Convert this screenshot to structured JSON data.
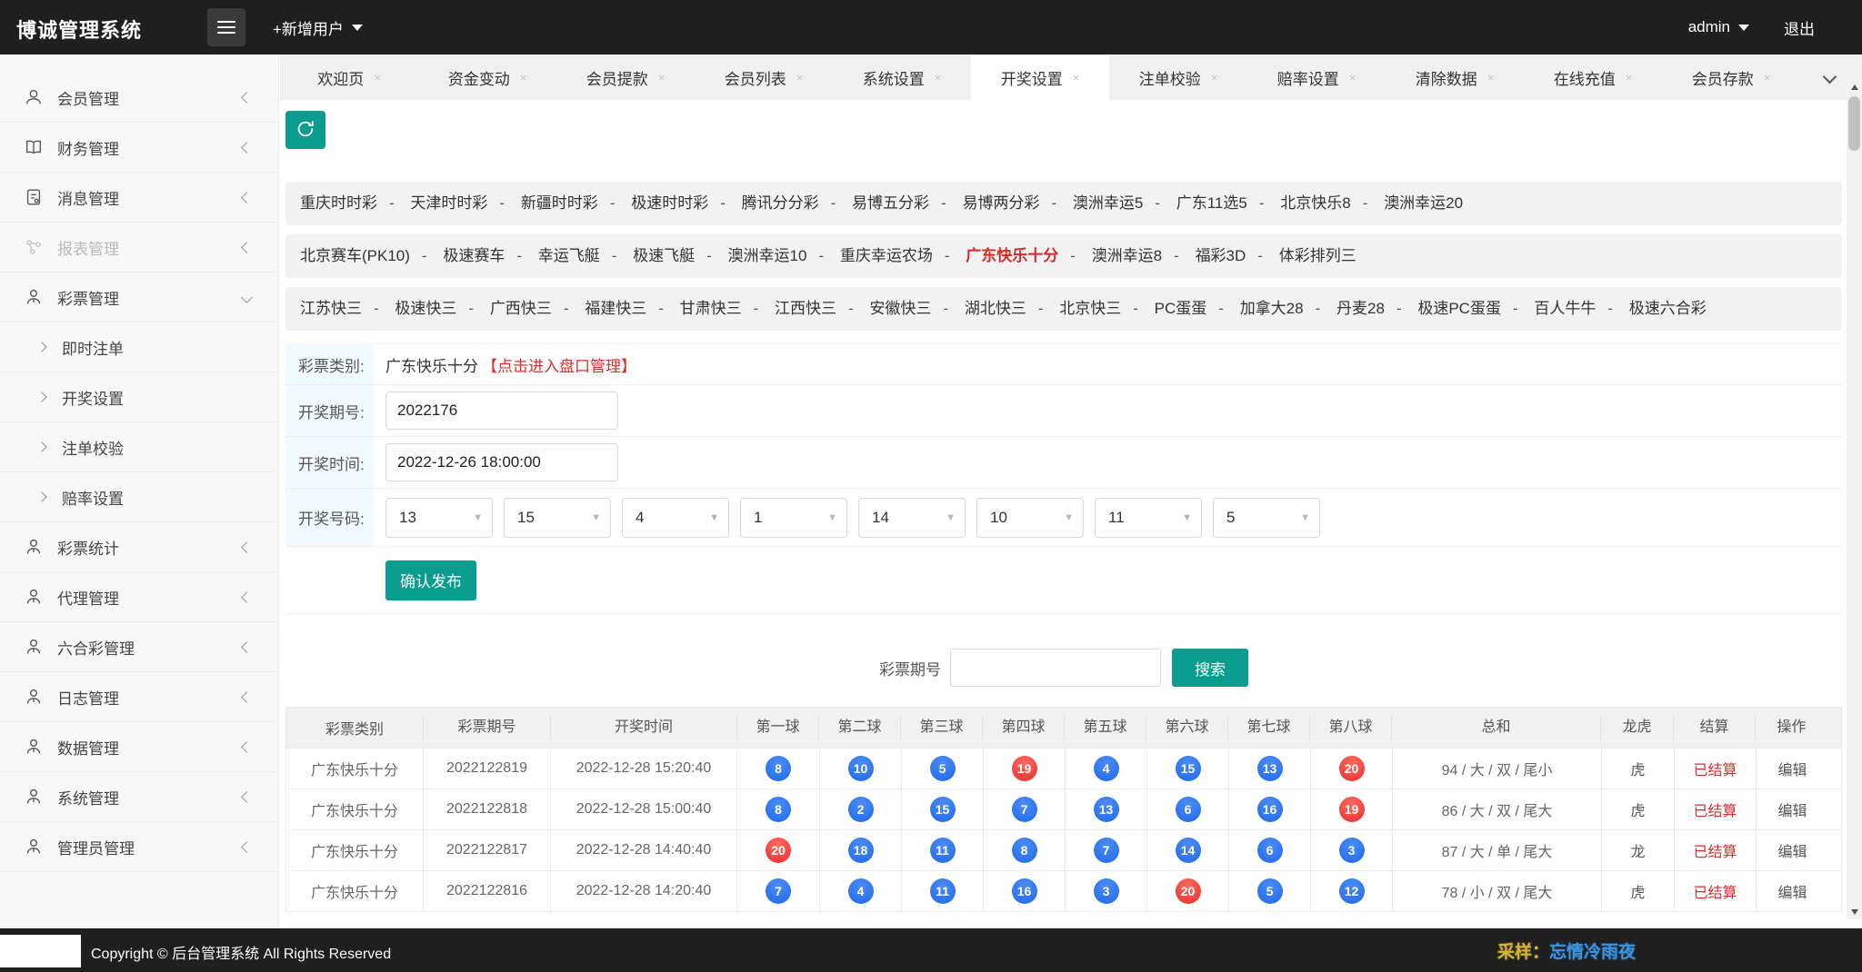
{
  "topbar": {
    "title": "博诚管理系统",
    "add_user_label": "+新增用户",
    "username": "admin",
    "logout_label": "退出"
  },
  "icons": {
    "close": "×",
    "select_caret": "▼"
  },
  "tabs": [
    {
      "label": "欢迎页",
      "active": "false"
    },
    {
      "label": "资金变动",
      "active": "false"
    },
    {
      "label": "会员提款",
      "active": "false"
    },
    {
      "label": "会员列表",
      "active": "false"
    },
    {
      "label": "系统设置",
      "active": "false"
    },
    {
      "label": "开奖设置",
      "active": "true"
    },
    {
      "label": "注单校验",
      "active": "false"
    },
    {
      "label": "赔率设置",
      "active": "false"
    },
    {
      "label": "清除数据",
      "active": "false"
    },
    {
      "label": "在线充值",
      "active": "false"
    },
    {
      "label": "会员存款",
      "active": "false"
    }
  ],
  "sidebar": {
    "items": [
      {
        "label": "会员管理",
        "icon": "user",
        "type": "top",
        "chevron": "left",
        "disabled": "false"
      },
      {
        "label": "财务管理",
        "icon": "book",
        "type": "top",
        "chevron": "left",
        "disabled": "false"
      },
      {
        "label": "消息管理",
        "icon": "doc",
        "type": "top",
        "chevron": "left",
        "disabled": "false"
      },
      {
        "label": "报表管理",
        "icon": "nodes",
        "type": "top",
        "chevron": "left",
        "disabled": "true"
      },
      {
        "label": "彩票管理",
        "icon": "user-tie",
        "type": "top",
        "chevron": "down",
        "disabled": "false"
      },
      {
        "label": "即时注单",
        "icon": "",
        "type": "sub",
        "chevron": "",
        "disabled": "false"
      },
      {
        "label": "开奖设置",
        "icon": "",
        "type": "sub",
        "chevron": "",
        "disabled": "false"
      },
      {
        "label": "注单校验",
        "icon": "",
        "type": "sub",
        "chevron": "",
        "disabled": "false"
      },
      {
        "label": "赔率设置",
        "icon": "",
        "type": "sub",
        "chevron": "",
        "disabled": "false"
      },
      {
        "label": "彩票统计",
        "icon": "user-tie",
        "type": "top",
        "chevron": "left",
        "disabled": "false"
      },
      {
        "label": "代理管理",
        "icon": "user-tie",
        "type": "top",
        "chevron": "left",
        "disabled": "false"
      },
      {
        "label": "六合彩管理",
        "icon": "user-tie",
        "type": "top",
        "chevron": "left",
        "disabled": "false"
      },
      {
        "label": "日志管理",
        "icon": "user-tie",
        "type": "top",
        "chevron": "left",
        "disabled": "false"
      },
      {
        "label": "数据管理",
        "icon": "user-tie",
        "type": "top",
        "chevron": "left",
        "disabled": "false"
      },
      {
        "label": "系统管理",
        "icon": "user-tie",
        "type": "top",
        "chevron": "left",
        "disabled": "false"
      },
      {
        "label": "管理员管理",
        "icon": "user-tie",
        "type": "top",
        "chevron": "left",
        "disabled": "false"
      }
    ]
  },
  "lottery_nav": {
    "rows": [
      {
        "links": [
          {
            "label": "重庆时时彩",
            "hot": "false"
          },
          {
            "label": "天津时时彩",
            "hot": "false"
          },
          {
            "label": "新疆时时彩",
            "hot": "false"
          },
          {
            "label": "极速时时彩",
            "hot": "false"
          },
          {
            "label": "腾讯分分彩",
            "hot": "false"
          },
          {
            "label": "易博五分彩",
            "hot": "false"
          },
          {
            "label": "易博两分彩",
            "hot": "false"
          },
          {
            "label": "澳洲幸运5",
            "hot": "false"
          },
          {
            "label": "广东11选5",
            "hot": "false"
          },
          {
            "label": "北京快乐8",
            "hot": "false"
          },
          {
            "label": "澳洲幸运20",
            "hot": "false"
          }
        ]
      },
      {
        "links": [
          {
            "label": "北京赛车(PK10)",
            "hot": "false"
          },
          {
            "label": "极速赛车",
            "hot": "false"
          },
          {
            "label": "幸运飞艇",
            "hot": "false"
          },
          {
            "label": "极速飞艇",
            "hot": "false"
          },
          {
            "label": "澳洲幸运10",
            "hot": "false"
          },
          {
            "label": "重庆幸运农场",
            "hot": "false"
          },
          {
            "label": "广东快乐十分",
            "hot": "true"
          },
          {
            "label": "澳洲幸运8",
            "hot": "false"
          },
          {
            "label": "福彩3D",
            "hot": "false"
          },
          {
            "label": "体彩排列三",
            "hot": "false"
          }
        ]
      },
      {
        "links": [
          {
            "label": "江苏快三",
            "hot": "false"
          },
          {
            "label": "极速快三",
            "hot": "false"
          },
          {
            "label": "广西快三",
            "hot": "false"
          },
          {
            "label": "福建快三",
            "hot": "false"
          },
          {
            "label": "甘肃快三",
            "hot": "false"
          },
          {
            "label": "江西快三",
            "hot": "false"
          },
          {
            "label": "安徽快三",
            "hot": "false"
          },
          {
            "label": "湖北快三",
            "hot": "false"
          },
          {
            "label": "北京快三",
            "hot": "false"
          },
          {
            "label": "PC蛋蛋",
            "hot": "false"
          },
          {
            "label": "加拿大28",
            "hot": "false"
          },
          {
            "label": "丹麦28",
            "hot": "false"
          },
          {
            "label": "极速PC蛋蛋",
            "hot": "false"
          },
          {
            "label": "百人牛牛",
            "hot": "false"
          },
          {
            "label": "极速六合彩",
            "hot": "false"
          }
        ]
      }
    ]
  },
  "form": {
    "category_label": "彩票类别:",
    "category_value": "广东快乐十分",
    "category_link": "【点击进入盘口管理】",
    "issue_label": "开奖期号:",
    "issue_value": "2022176",
    "time_label": "开奖时间:",
    "time_value": "2022-12-26 18:00:00",
    "numbers_label": "开奖号码:",
    "numbers": [
      {
        "value": "13"
      },
      {
        "value": "15"
      },
      {
        "value": "4"
      },
      {
        "value": "1"
      },
      {
        "value": "14"
      },
      {
        "value": "10"
      },
      {
        "value": "11"
      },
      {
        "value": "5"
      }
    ],
    "submit_label": "确认发布"
  },
  "search": {
    "label": "彩票期号",
    "value": "",
    "button_label": "搜索"
  },
  "table": {
    "headers": [
      "彩票类别",
      "彩票期号",
      "开奖时间",
      "第一球",
      "第二球",
      "第三球",
      "第四球",
      "第五球",
      "第六球",
      "第七球",
      "第八球",
      "总和",
      "龙虎",
      "结算",
      "操作"
    ],
    "rows": [
      {
        "category": "广东快乐十分",
        "issue": "2022122819",
        "time": "2022-12-28 15:20:40",
        "balls": [
          {
            "v": "8",
            "color": "blue"
          },
          {
            "v": "10",
            "color": "blue"
          },
          {
            "v": "5",
            "color": "blue"
          },
          {
            "v": "19",
            "color": "red"
          },
          {
            "v": "4",
            "color": "blue"
          },
          {
            "v": "15",
            "color": "blue"
          },
          {
            "v": "13",
            "color": "blue"
          },
          {
            "v": "20",
            "color": "red"
          }
        ],
        "sum": "94 / 大 / 双 / 尾小",
        "dragon_tiger": "虎",
        "settle": "已结算",
        "action": "编辑"
      },
      {
        "category": "广东快乐十分",
        "issue": "2022122818",
        "time": "2022-12-28 15:00:40",
        "balls": [
          {
            "v": "8",
            "color": "blue"
          },
          {
            "v": "2",
            "color": "blue"
          },
          {
            "v": "15",
            "color": "blue"
          },
          {
            "v": "7",
            "color": "blue"
          },
          {
            "v": "13",
            "color": "blue"
          },
          {
            "v": "6",
            "color": "blue"
          },
          {
            "v": "16",
            "color": "blue"
          },
          {
            "v": "19",
            "color": "red"
          }
        ],
        "sum": "86 / 大 / 双 / 尾大",
        "dragon_tiger": "虎",
        "settle": "已结算",
        "action": "编辑"
      },
      {
        "category": "广东快乐十分",
        "issue": "2022122817",
        "time": "2022-12-28 14:40:40",
        "balls": [
          {
            "v": "20",
            "color": "red"
          },
          {
            "v": "18",
            "color": "blue"
          },
          {
            "v": "11",
            "color": "blue"
          },
          {
            "v": "8",
            "color": "blue"
          },
          {
            "v": "7",
            "color": "blue"
          },
          {
            "v": "14",
            "color": "blue"
          },
          {
            "v": "6",
            "color": "blue"
          },
          {
            "v": "3",
            "color": "blue"
          }
        ],
        "sum": "87 / 大 / 单 / 尾大",
        "dragon_tiger": "龙",
        "settle": "已结算",
        "action": "编辑"
      },
      {
        "category": "广东快乐十分",
        "issue": "2022122816",
        "time": "2022-12-28 14:20:40",
        "balls": [
          {
            "v": "7",
            "color": "blue"
          },
          {
            "v": "4",
            "color": "blue"
          },
          {
            "v": "11",
            "color": "blue"
          },
          {
            "v": "16",
            "color": "blue"
          },
          {
            "v": "3",
            "color": "blue"
          },
          {
            "v": "20",
            "color": "red"
          },
          {
            "v": "5",
            "color": "blue"
          },
          {
            "v": "12",
            "color": "blue"
          }
        ],
        "sum": "78 / 小 / 双 / 尾大",
        "dragon_tiger": "虎",
        "settle": "已结算",
        "action": "编辑"
      }
    ]
  },
  "footer": {
    "copyright": "Copyright © 后台管理系统 All Rights Reserved",
    "sample_label": "采样：",
    "sample_value": "忘情冷雨夜"
  },
  "colors": {
    "accent_teal": "#0a9c8c",
    "ball_blue": "#2e7af0",
    "ball_red": "#ef3b3b",
    "hot_red": "#d42a2a",
    "settle_red": "#e02c2c"
  }
}
